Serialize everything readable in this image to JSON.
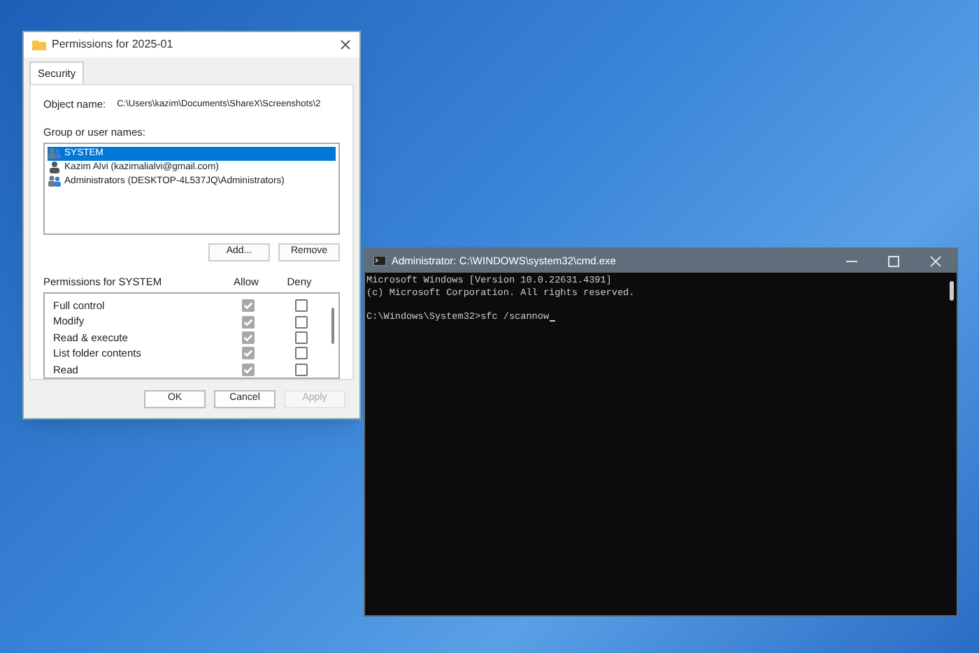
{
  "dialog": {
    "title": "Permissions for 2025-01",
    "tabs": [
      {
        "label": "Security",
        "selected": true
      }
    ],
    "object_name_label": "Object name:",
    "object_name": "C:\\Users\\kazim\\Documents\\ShareX\\Screenshots\\2",
    "group_label": "Group or user names:",
    "users": [
      {
        "name": "SYSTEM",
        "kind": "group",
        "selected": true
      },
      {
        "name": "Kazim Alvi (kazimalialvi@gmail.com)",
        "kind": "user",
        "selected": false
      },
      {
        "name": "Administrators (DESKTOP-4L537JQ\\Administrators)",
        "kind": "group",
        "selected": false
      }
    ],
    "user_buttons": [
      "Add...",
      "Remove"
    ],
    "permissions_label": "Permissions for SYSTEM",
    "allow_label": "Allow",
    "deny_label": "Deny",
    "permissions": [
      {
        "name": "Full control",
        "allow": true,
        "deny": false
      },
      {
        "name": "Modify",
        "allow": true,
        "deny": false
      },
      {
        "name": "Read & execute",
        "allow": true,
        "deny": false
      },
      {
        "name": "List folder contents",
        "allow": true,
        "deny": false
      },
      {
        "name": "Read",
        "allow": true,
        "deny": false
      }
    ],
    "buttons": [
      {
        "label": "OK",
        "disabled": false
      },
      {
        "label": "Cancel",
        "disabled": false
      },
      {
        "label": "Apply",
        "disabled": true
      }
    ]
  },
  "terminal": {
    "title": "Administrator: C:\\WINDOWS\\system32\\cmd.exe",
    "lines": [
      {
        "text": "Microsoft Windows [Version 10.0.22631.4391]",
        "blank_before": false
      },
      {
        "text": "(c) Microsoft Corporation. All rights reserved.",
        "blank_before": false
      },
      {
        "text": "C:\\Windows\\System32>sfc /scannow",
        "blank_before": true
      }
    ]
  }
}
